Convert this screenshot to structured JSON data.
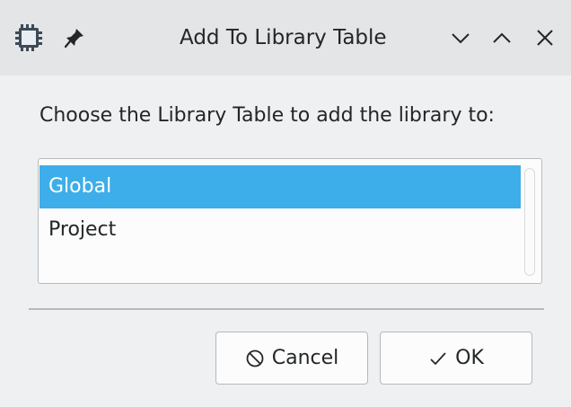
{
  "window": {
    "title": "Add To Library Table",
    "app_icon": "kicad-footprint-icon",
    "pin_icon": "pin-icon",
    "controls": [
      "minimize-icon",
      "maximize-icon",
      "close-icon"
    ]
  },
  "dialog": {
    "prompt": "Choose the Library Table to add the library to:",
    "options": [
      {
        "label": "Global",
        "selected": true
      },
      {
        "label": "Project",
        "selected": false
      }
    ]
  },
  "buttons": {
    "cancel_label": "Cancel",
    "cancel_icon": "cancel-icon",
    "ok_label": "OK",
    "ok_icon": "checkmark-icon"
  },
  "colors": {
    "selection": "#3daee9",
    "background": "#eff0f1",
    "titlebar": "#e3e5e7"
  }
}
